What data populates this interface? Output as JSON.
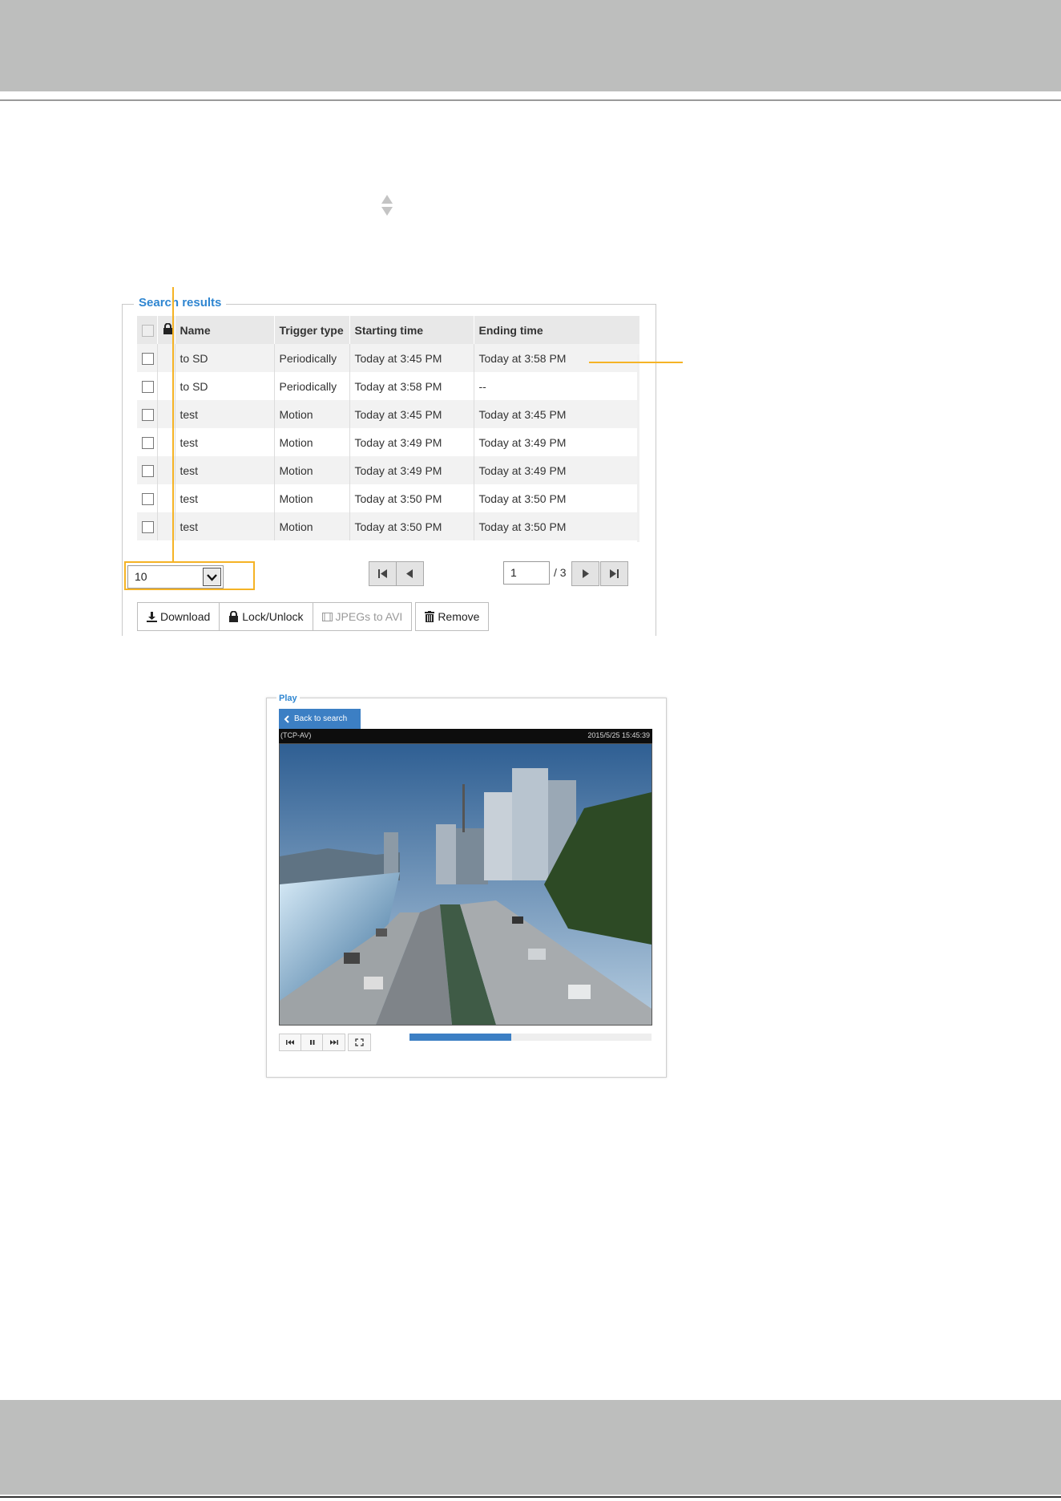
{
  "sort_icon": "sort-arrows-icon",
  "search_results": {
    "legend": "Search results",
    "columns": {
      "select_all": "checkbox",
      "lock": "lock-icon",
      "name": "Name",
      "trigger_type": "Trigger type",
      "starting_time": "Starting time",
      "ending_time": "Ending time"
    },
    "rows": [
      {
        "name": "to SD",
        "trigger": "Periodically",
        "start": "Today at 3:45 PM",
        "end": "Today at 3:58 PM"
      },
      {
        "name": "to SD",
        "trigger": "Periodically",
        "start": "Today at 3:58 PM",
        "end": "--"
      },
      {
        "name": "test",
        "trigger": "Motion",
        "start": "Today at 3:45 PM",
        "end": "Today at 3:45 PM"
      },
      {
        "name": "test",
        "trigger": "Motion",
        "start": "Today at 3:49 PM",
        "end": "Today at 3:49 PM"
      },
      {
        "name": "test",
        "trigger": "Motion",
        "start": "Today at 3:49 PM",
        "end": "Today at 3:49 PM"
      },
      {
        "name": "test",
        "trigger": "Motion",
        "start": "Today at 3:50 PM",
        "end": "Today at 3:50 PM"
      },
      {
        "name": "test",
        "trigger": "Motion",
        "start": "Today at 3:50 PM",
        "end": "Today at 3:50 PM"
      }
    ],
    "page_size": "10",
    "current_page": "1",
    "total_pages": "/ 3",
    "actions": {
      "download": "Download",
      "lock_unlock": "Lock/Unlock",
      "jpegs_to_avi": "JPEGs to AVI",
      "remove": "Remove"
    }
  },
  "play": {
    "legend": "Play",
    "back_button": "Back to search",
    "stream_label": "(TCP-AV)",
    "timestamp": "2015/5/25 15:45:39",
    "progress_fraction": 0.42
  },
  "colors": {
    "accent": "#2f86d1",
    "annotation": "#f5b325",
    "band": "#bdbebd"
  }
}
